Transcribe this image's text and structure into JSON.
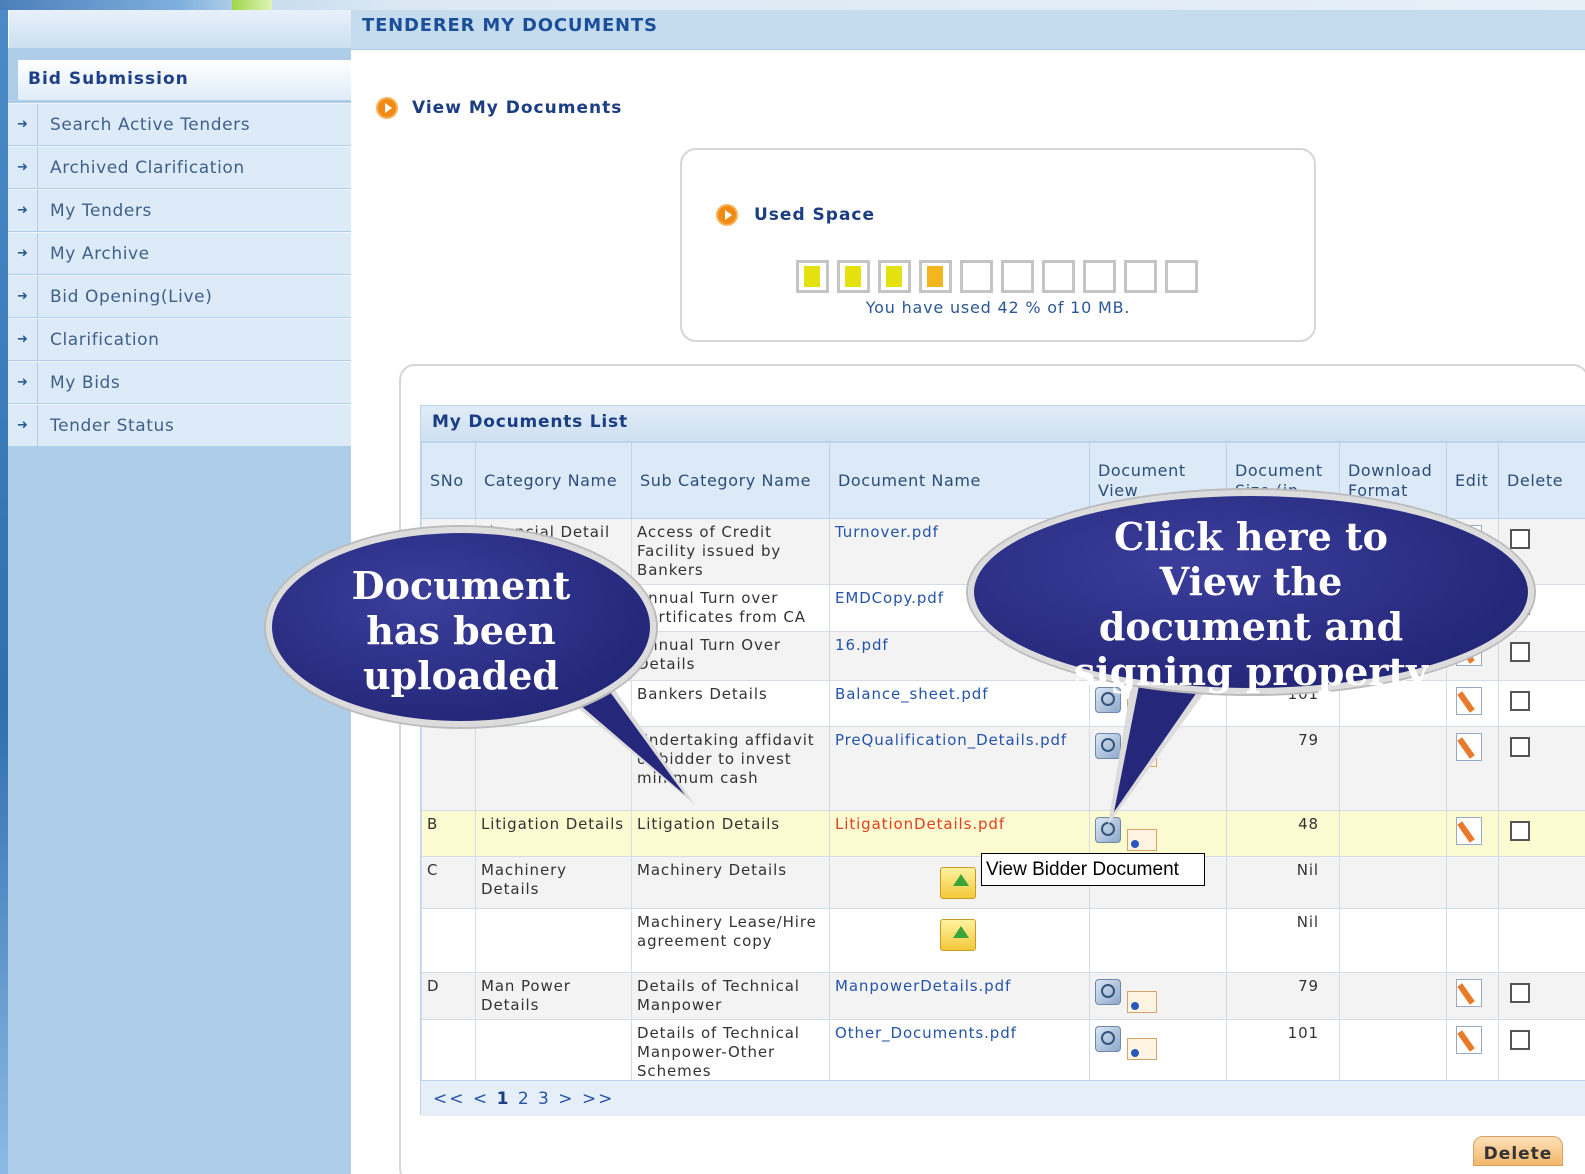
{
  "page": {
    "title": "TENDERER MY DOCUMENTS"
  },
  "sidebar": {
    "heading": "Bid Submission",
    "items": [
      {
        "label": "Search Active Tenders"
      },
      {
        "label": "Archived Clarification"
      },
      {
        "label": "My Tenders"
      },
      {
        "label": "My Archive"
      },
      {
        "label": "Bid Opening(Live)"
      },
      {
        "label": "Clarification"
      },
      {
        "label": "My Bids"
      },
      {
        "label": "Tender Status"
      }
    ]
  },
  "view": {
    "title": "View My Documents"
  },
  "space": {
    "title": "Used Space",
    "text": "You have used 42 % of 10 MB.",
    "used_fraction": 0.42,
    "total_blocks": 10,
    "filled_blocks": 4
  },
  "list": {
    "title": "My Documents List",
    "columns": [
      "SNo",
      "Category Name",
      "Sub Category Name",
      "Document Name",
      "Document View",
      "Document Size (in",
      "Download Format",
      "Edit",
      "Delete"
    ],
    "rows": [
      {
        "sno": "",
        "category": "Financial Detail",
        "subcategory": "Access of Credit Facility issued by Bankers",
        "document": "Turnover.pdf",
        "size": ""
      },
      {
        "sno": "",
        "category": "",
        "subcategory": "Annual Turn over Certificates from CA",
        "document": "EMDCopy.pdf",
        "size": ""
      },
      {
        "sno": "",
        "category": "",
        "subcategory": "Annual Turn Over Details",
        "document": "16.pdf",
        "size": ""
      },
      {
        "sno": "",
        "category": "",
        "subcategory": "Bankers Details",
        "document": "Balance_sheet.pdf",
        "size": "101"
      },
      {
        "sno": "",
        "category": "",
        "subcategory": "Undertaking affidavit of bidder to invest minimum cash",
        "document": "PreQualification_Details.pdf",
        "size": "79"
      },
      {
        "sno": "B",
        "category": "Litigation Details",
        "subcategory": "Litigation Details",
        "document": "LitigationDetails.pdf",
        "size": "48"
      },
      {
        "sno": "C",
        "category": "Machinery Details",
        "subcategory": "Machinery Details",
        "document": "",
        "size": "Nil"
      },
      {
        "sno": "",
        "category": "",
        "subcategory": "Machinery Lease/Hire agreement copy",
        "document": "",
        "size": "Nil"
      },
      {
        "sno": "D",
        "category": "Man Power Details",
        "subcategory": "Details of Technical Manpower",
        "document": "ManpowerDetails.pdf",
        "size": "79"
      },
      {
        "sno": "",
        "category": "",
        "subcategory": "Details of Technical Manpower-Other Schemes",
        "document": "Other_Documents.pdf",
        "size": "101"
      }
    ],
    "pager": {
      "first": "<<",
      "prev": "<",
      "pages": [
        "1",
        "2",
        "3"
      ],
      "next": ">",
      "last": ">>"
    }
  },
  "tooltip": "View Bidder Document",
  "delete_label": "Delete",
  "callouts": {
    "left": "Document has been uploaded",
    "right": "Click here to View the document and signing property"
  },
  "colors": {
    "accent": "#1b3d84",
    "bubble": "#25287a",
    "highlight_row": "#fbfad0",
    "link": "#2454a9"
  }
}
